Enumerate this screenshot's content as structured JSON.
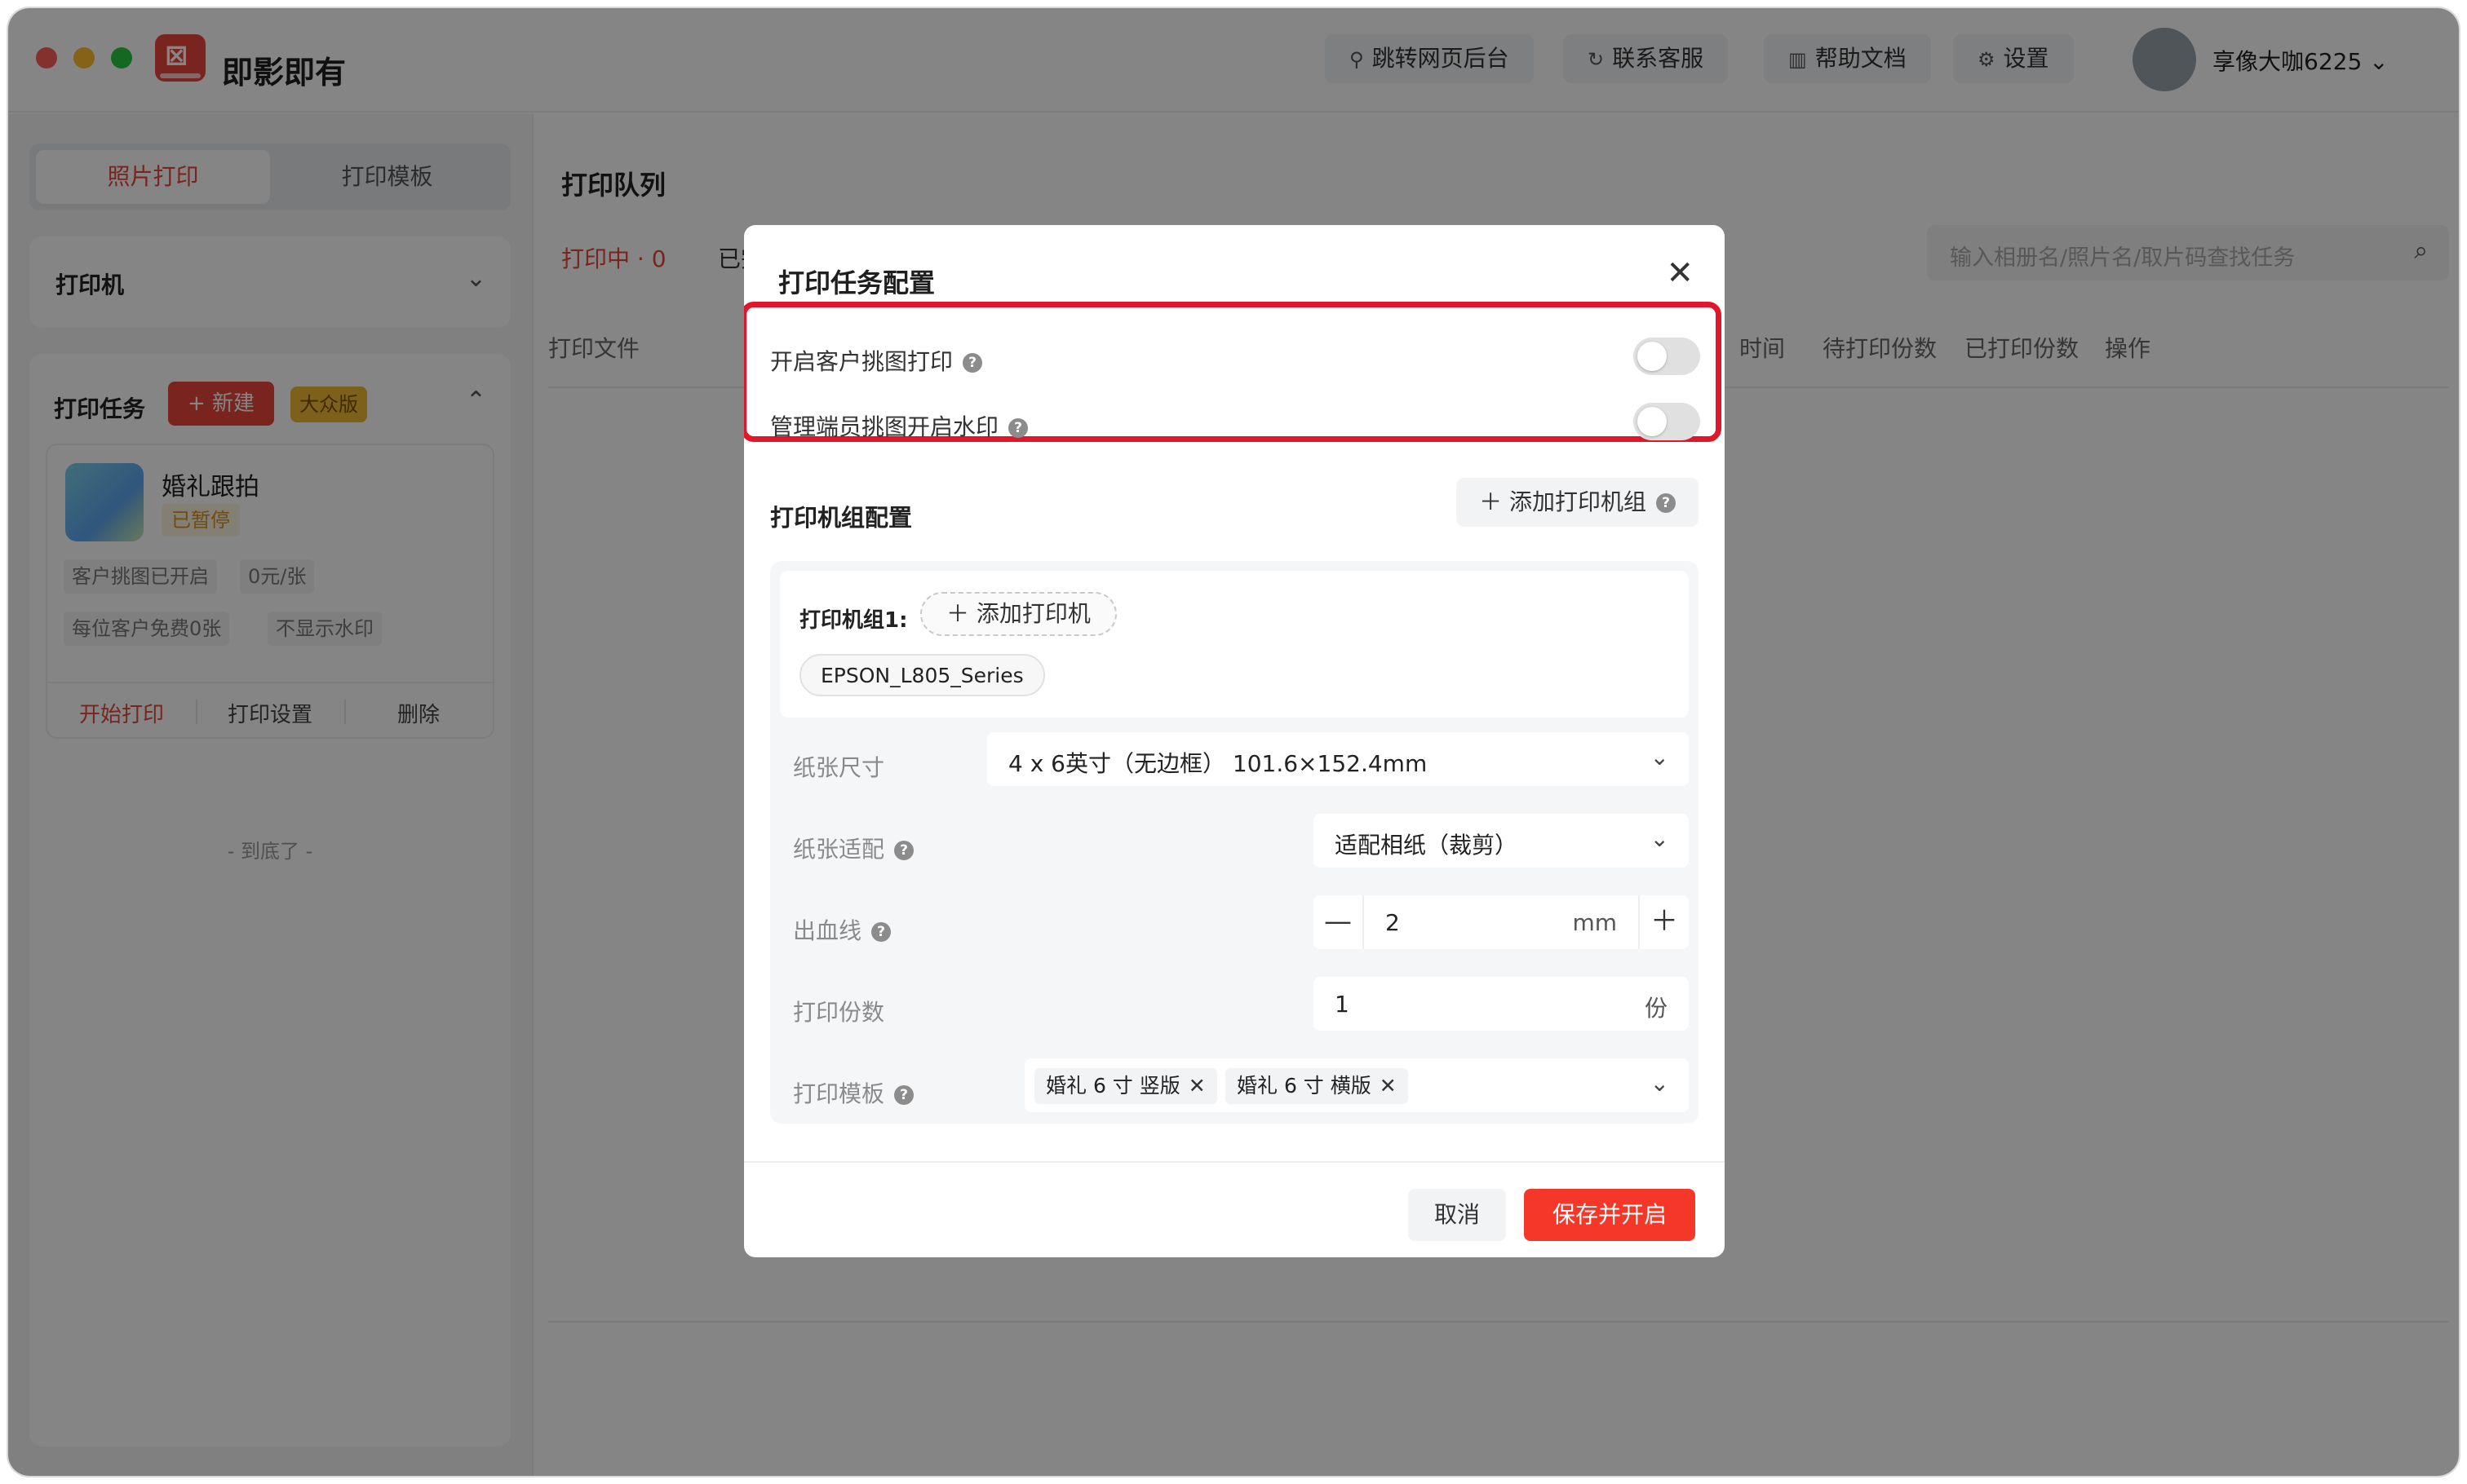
{
  "app": {
    "name": "即影即有",
    "logo_glyph": "⊠"
  },
  "topbar": {
    "buttons": [
      {
        "icon": "user-icon",
        "glyph": "⚲",
        "label": "跳转网页后台"
      },
      {
        "icon": "headset-icon",
        "glyph": "↻",
        "label": "联系客服"
      },
      {
        "icon": "book-icon",
        "glyph": "▥",
        "label": "帮助文档"
      },
      {
        "icon": "gear-icon",
        "glyph": "⚙",
        "label": "设置"
      }
    ],
    "username": "享像大咖6225",
    "user_chevron": "⌄"
  },
  "sidebar": {
    "tabs": [
      "照片打印",
      "打印模板"
    ],
    "printer_label": "打印机",
    "printer_chevron": "⌄",
    "tasks_title": "打印任务",
    "new_label": "+ 新建",
    "edition_badge": "大众版",
    "collapse_chevron": "⌃",
    "task": {
      "name": "婚礼跟拍",
      "status": "已暂停",
      "tags": [
        "客户挑图已开启",
        "0元/张",
        "每位客户免费0张",
        "不显示水印"
      ],
      "actions": [
        "开始打印",
        "打印设置",
        "删除"
      ]
    },
    "bottom_tip": "- 到底了 -"
  },
  "main": {
    "title": "打印队列",
    "tabs": [
      "打印中 · 0",
      "已完"
    ],
    "search_placeholder": "输入相册名/照片名/取片码查找任务",
    "search_icon": "⌕",
    "columns": [
      "打印文件",
      "时间",
      "待打印份数",
      "已打印份数",
      "操作"
    ]
  },
  "modal": {
    "title": "打印任务配置",
    "close": "✕",
    "help_glyph": "?",
    "switches": [
      {
        "label": "开启客户挑图打印",
        "on": false
      },
      {
        "label": "管理端员挑图开启水印",
        "on": false
      }
    ],
    "group_section_title": "打印机组配置",
    "add_group_label": "＋ 添加打印机组",
    "group": {
      "label": "打印机组1:",
      "add_printer_label": "＋ 添加打印机",
      "printer_chip": "EPSON_L805_Series"
    },
    "form": {
      "paper_size_label": "纸张尺寸",
      "paper_size_value": "4 x 6英寸（无边框） 101.6×152.4mm",
      "paper_fit_label": "纸张适配",
      "paper_fit_value": "适配相纸（裁剪）",
      "bleed_label": "出血线",
      "bleed_value": "2",
      "bleed_unit": "mm",
      "minus": "—",
      "plus": "＋",
      "copies_label": "打印份数",
      "copies_value": "1",
      "copies_unit": "份",
      "template_label": "打印模板",
      "templates": [
        "婚礼 6 寸 竖版",
        "婚礼 6 寸 横版"
      ],
      "remove_glyph": "✕",
      "dropdown_chevron": "⌄"
    },
    "cancel_label": "取消",
    "save_label": "保存并开启"
  }
}
